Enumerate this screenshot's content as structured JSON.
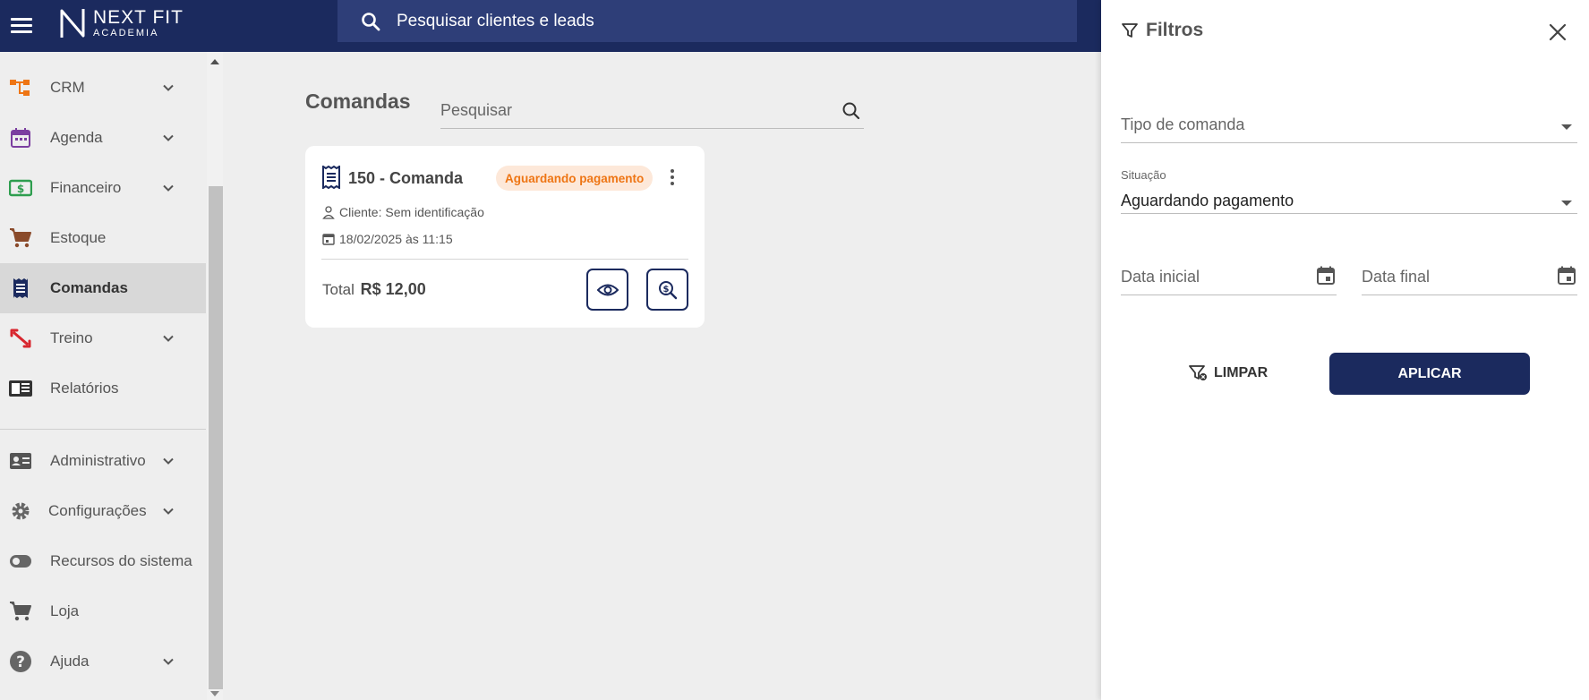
{
  "topbar": {
    "logo_brand": "NEXT FIT",
    "logo_sub": "ACADEMIA",
    "search_placeholder": "Pesquisar clientes e leads"
  },
  "sidebar": {
    "items": [
      {
        "label": "CRM",
        "icon": "crm-icon",
        "has_chevron": true
      },
      {
        "label": "Agenda",
        "icon": "calendar-icon",
        "has_chevron": true
      },
      {
        "label": "Financeiro",
        "icon": "money-icon",
        "has_chevron": true
      },
      {
        "label": "Estoque",
        "icon": "cart-icon",
        "has_chevron": false
      },
      {
        "label": "Comandas",
        "icon": "receipt-icon",
        "has_chevron": false,
        "active": true
      },
      {
        "label": "Treino",
        "icon": "dumbbell-icon",
        "has_chevron": true
      },
      {
        "label": "Relatórios",
        "icon": "report-icon",
        "has_chevron": false
      },
      {
        "label": "Administrativo",
        "icon": "id-card-icon",
        "has_chevron": true
      },
      {
        "label": "Configurações",
        "icon": "gear-icon",
        "has_chevron": true
      },
      {
        "label": "Recursos do sistema",
        "icon": "toggle-icon",
        "has_chevron": false
      },
      {
        "label": "Loja",
        "icon": "cart-icon",
        "has_chevron": false
      },
      {
        "label": "Ajuda",
        "icon": "help-icon",
        "has_chevron": true
      }
    ]
  },
  "main": {
    "title": "Comandas",
    "search_placeholder": "Pesquisar",
    "card": {
      "title": "150 - Comanda",
      "status": "Aguardando pagamento",
      "client": "Cliente: Sem identificação",
      "date": "18/02/2025 às 11:15",
      "total_label": "Total",
      "total_value": "R$ 12,00"
    }
  },
  "filters": {
    "title": "Filtros",
    "tipo_placeholder": "Tipo de comanda",
    "situacao_label": "Situação",
    "situacao_value": "Aguardando pagamento",
    "data_inicial_placeholder": "Data inicial",
    "data_final_placeholder": "Data final",
    "clear_label": "LIMPAR",
    "apply_label": "APLICAR"
  },
  "colors": {
    "primary": "#1b2a5e",
    "badge_bg": "#fde8d9",
    "badge_text": "#ee7514"
  }
}
